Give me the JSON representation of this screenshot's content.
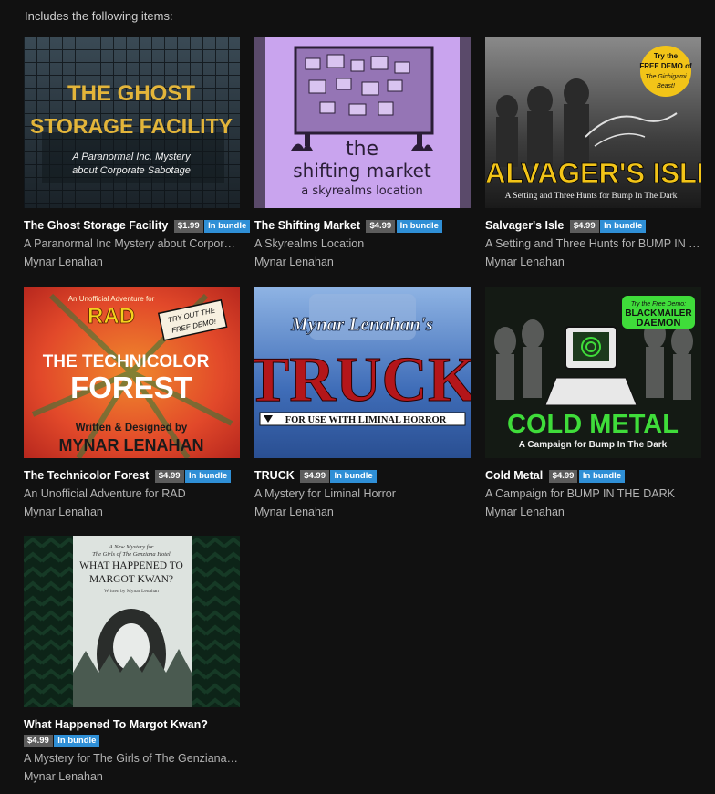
{
  "heading": "Includes the following items:",
  "items": [
    {
      "title": "The Ghost Storage Facility",
      "price": "$1.99",
      "badge": "In bundle",
      "description": "A Paranormal Inc Mystery about Corporate Sabotage",
      "author": "Mynar Lenahan",
      "cover": {
        "line1": "THE GHOST",
        "line2": "STORAGE FACILITY",
        "sub1": "A Paranormal Inc. Mystery",
        "sub2": "about Corporate Sabotage"
      }
    },
    {
      "title": "The Shifting Market",
      "price": "$4.99",
      "badge": "In bundle",
      "description": "A Skyrealms Location",
      "author": "Mynar Lenahan",
      "cover": {
        "line1": "the",
        "line2": "shifting market",
        "sub1": "a skyrealms location"
      }
    },
    {
      "title": "Salvager's Isle",
      "price": "$4.99",
      "badge": "In bundle",
      "description": "A Setting and Three Hunts for BUMP IN THE DARK",
      "author": "Mynar Lenahan",
      "cover": {
        "line1": "SALVAGER'S ISLE",
        "sub1": "A Setting and Three Hunts for Bump In The Dark",
        "sticker1": "Try the",
        "sticker2": "FREE DEMO of",
        "sticker3": "The Gichigami",
        "sticker4": "Beast!"
      }
    },
    {
      "title": "The Technicolor Forest",
      "price": "$4.99",
      "badge": "In bundle",
      "description": "An Unofficial Adventure for RAD",
      "author": "Mynar Lenahan",
      "cover": {
        "top": "An Unofficial Adventure for",
        "rad": "RAD",
        "line1": "THE TECHNICOLOR",
        "line2": "FOREST",
        "sub1": "Written & Designed by",
        "sub2": "MYNAR LENAHAN",
        "stamp1": "TRY OUT THE",
        "stamp2": "FREE DEMO!"
      }
    },
    {
      "title": "TRUCK",
      "price": "$4.99",
      "badge": "In bundle",
      "description": "A Mystery for Liminal Horror",
      "author": "Mynar Lenahan",
      "cover": {
        "line1": "Mynar Lenahan's",
        "line2": "TRUCK",
        "sub1": "FOR USE WITH LIMINAL HORROR"
      }
    },
    {
      "title": "Cold Metal",
      "price": "$4.99",
      "badge": "In bundle",
      "description": "A Campaign for BUMP IN THE DARK",
      "author": "Mynar Lenahan",
      "cover": {
        "line1": "COLD METAL",
        "sub1": "A Campaign for Bump In The Dark",
        "sticker1": "Try the Free Demo:",
        "sticker2": "BLACKMAILER",
        "sticker3": "DAEMON"
      }
    },
    {
      "title": "What Happened To Margot Kwan?",
      "price": "$4.99",
      "badge": "In bundle",
      "description": "A Mystery for The Girls of The Genziana Hotel",
      "author": "Mynar Lenahan",
      "cover": {
        "top1": "A New Mystery for",
        "top2": "The Girls of The Genziana Hotel",
        "line1": "WHAT HAPPENED TO",
        "line2": "MARGOT KWAN?",
        "sub1": "Written by Mynar Lenahan"
      }
    }
  ],
  "colors": {
    "background": "#111111",
    "badge": "#2f8fd6",
    "price": "#5c5c5c"
  }
}
